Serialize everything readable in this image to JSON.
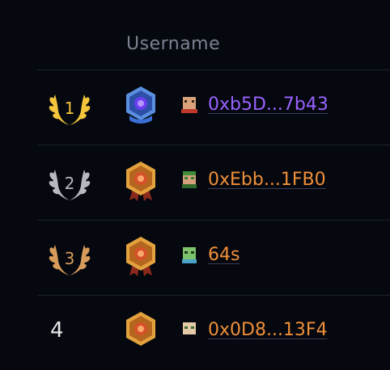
{
  "table": {
    "column_username": "Username",
    "rows": [
      {
        "rank": "1",
        "username": "0xb5D...7b43",
        "badge": "diamond-badge-icon",
        "color": "#9a62ff"
      },
      {
        "rank": "2",
        "username": "0xEbb...1FB0",
        "badge": "bronze-badge-icon",
        "color": "#f0903a"
      },
      {
        "rank": "3",
        "username": "64s",
        "badge": "bronze-badge-icon",
        "color": "#f0903a"
      },
      {
        "rank": "4",
        "username": "0x0D8...13F4",
        "badge": "bronze-badge-icon",
        "color": "#f0903a"
      }
    ]
  },
  "colors": {
    "gold": "#f5c53b",
    "silver": "#b7b9c2",
    "bronze": "#d79b5a",
    "purple_link": "#9a62ff",
    "orange_link": "#f0903a"
  }
}
